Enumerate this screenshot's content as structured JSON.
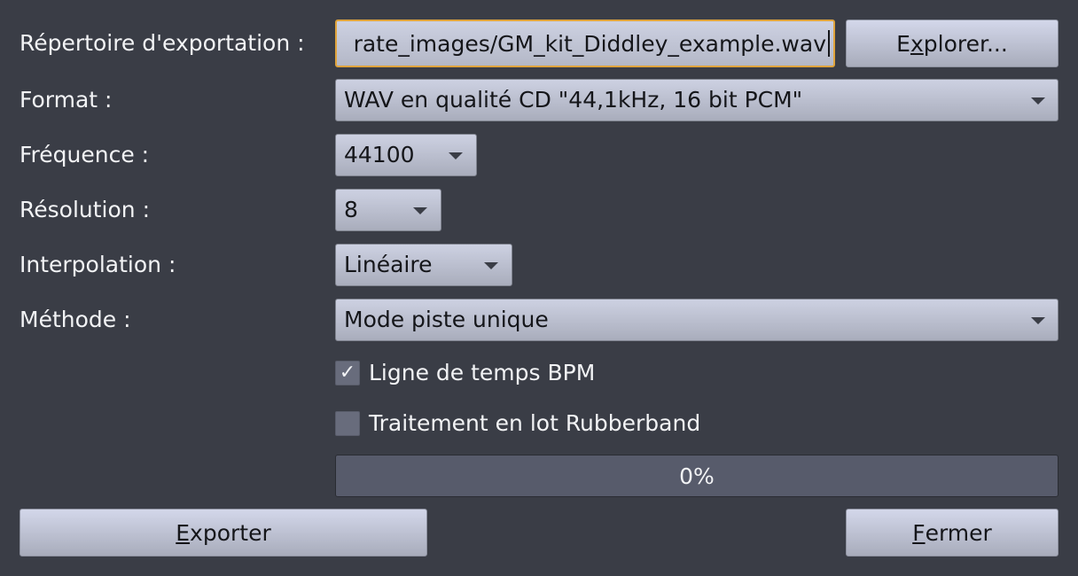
{
  "export_dir": {
    "label": "Répertoire d'exportation :",
    "value": "rate_images/GM_kit_Diddley_example.wav",
    "browse_pre": "E",
    "browse_ul": "x",
    "browse_post": "plorer..."
  },
  "format": {
    "label": "Format :",
    "value": "WAV en qualité CD  \"44,1kHz, 16 bit PCM\""
  },
  "frequency": {
    "label": "Fréquence :",
    "value": "44100"
  },
  "resolution": {
    "label": "Résolution :",
    "value": "8"
  },
  "interpolation": {
    "label": "Interpolation :",
    "value": "Linéaire"
  },
  "method": {
    "label": "Méthode :",
    "value": "Mode piste unique"
  },
  "bpm_timeline": {
    "label": "Ligne de temps BPM",
    "checked": true,
    "mark": "✓"
  },
  "rubberband": {
    "label": "Traitement en lot Rubberband",
    "checked": false
  },
  "progress": {
    "text": "0%",
    "value": 0
  },
  "buttons": {
    "export_ul": "E",
    "export_rest": "xporter",
    "close_ul": "F",
    "close_rest": "ermer"
  },
  "colors": {
    "background": "#3a3d46",
    "focus_border": "#e0a43c",
    "progress_bg": "#575b6b"
  }
}
